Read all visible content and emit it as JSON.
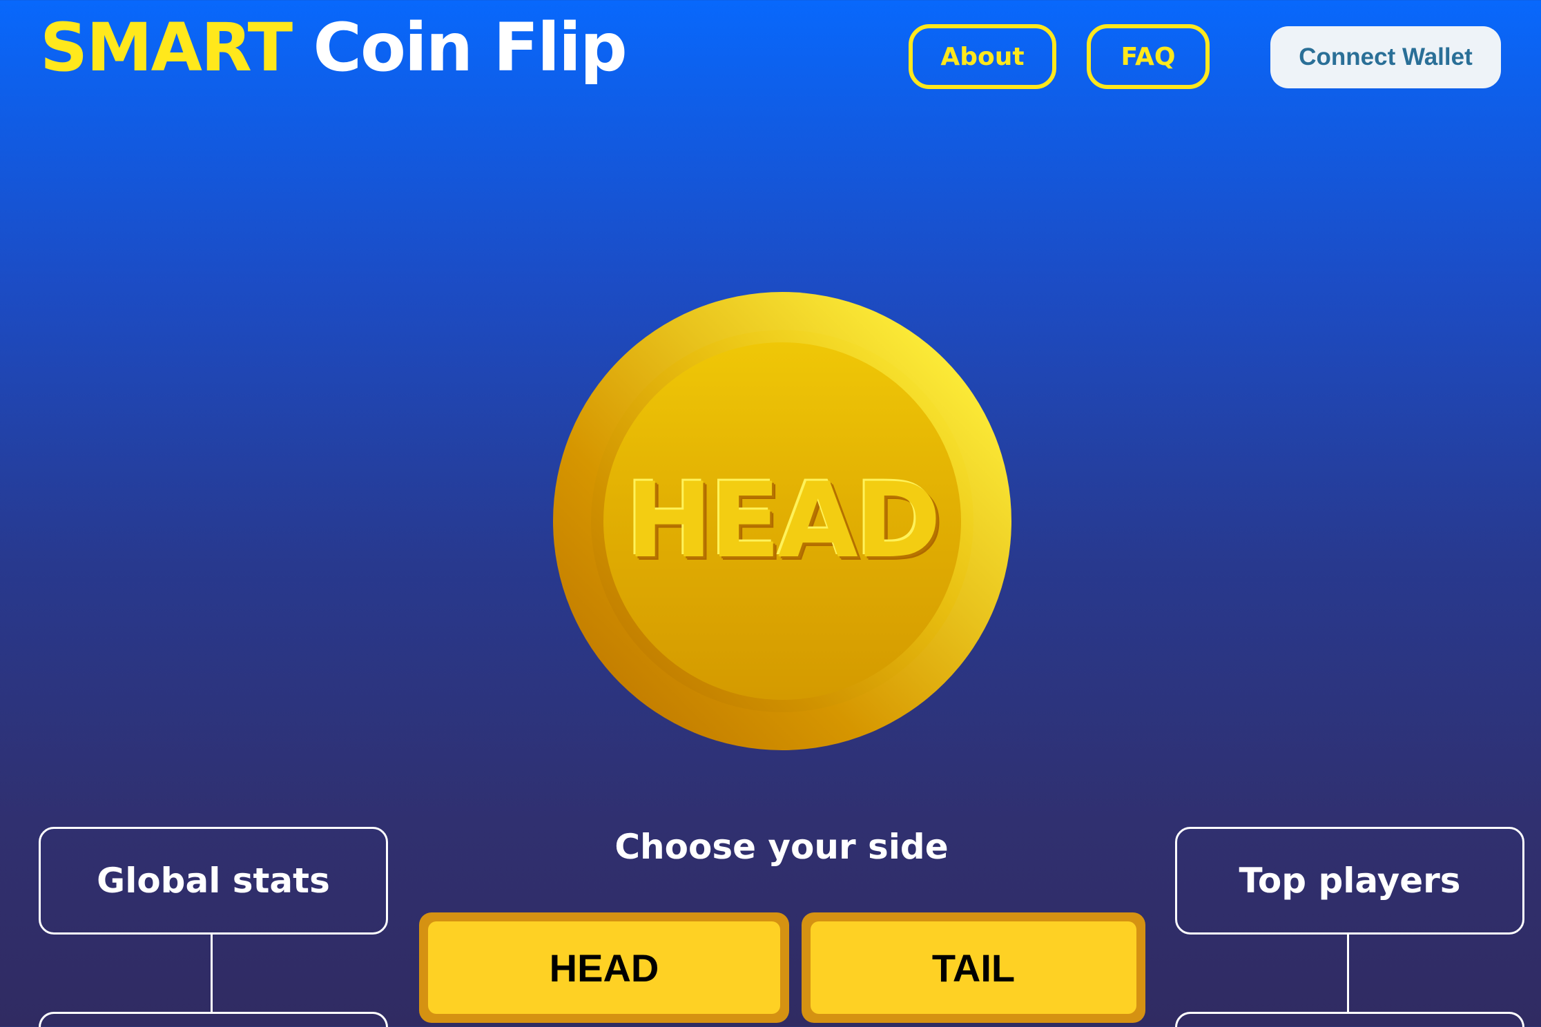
{
  "header": {
    "logo_highlight": "SMART",
    "logo_rest": "Coin Flip",
    "nav": {
      "about": "About",
      "faq": "FAQ"
    },
    "connect_wallet": "Connect Wallet"
  },
  "coin": {
    "face_label": "HEAD"
  },
  "left_panel": {
    "title": "Global stats"
  },
  "right_panel": {
    "title": "Top players"
  },
  "choose": {
    "title": "Choose your side",
    "head_label": "HEAD",
    "tail_label": "TAIL"
  },
  "colors": {
    "accent_yellow": "#ffe81c",
    "background_top": "#0868fc",
    "background_bottom": "#302b62",
    "coin_gold": "#e2b003",
    "button_yellow": "#fed124",
    "wallet_text": "#2a6f97"
  }
}
